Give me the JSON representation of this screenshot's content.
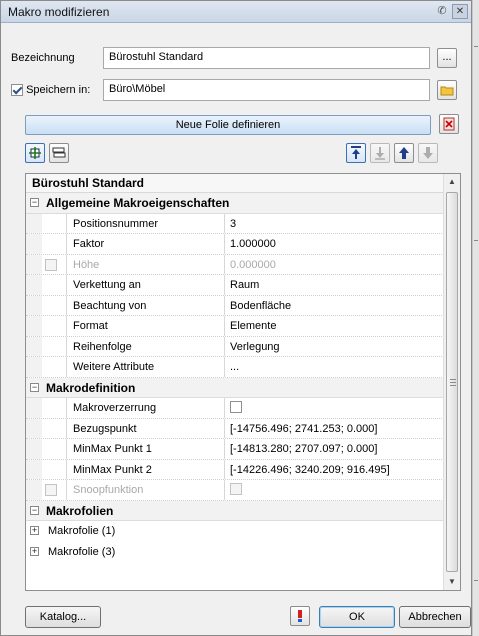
{
  "window": {
    "title": "Makro modifizieren"
  },
  "form": {
    "bezeichnung_label": "Bezeichnung",
    "bezeichnung_value": "Bürostuhl Standard",
    "browse_label": "...",
    "speichern_label": "Speichern in:",
    "speichern_checked": true,
    "speichern_value": "Büro\\Möbel"
  },
  "toolbar": {
    "neue_folie_label": "Neue Folie definieren"
  },
  "grid": {
    "header": "Bürostuhl Standard",
    "groups": {
      "allgemein": "Allgemeine Makroeigenschaften",
      "makrodefinition": "Makrodefinition",
      "makrofolien": "Makrofolien"
    },
    "allgemein_props": [
      {
        "name": "Positionsnummer",
        "value": "3"
      },
      {
        "name": "Faktor",
        "value": "1.000000"
      },
      {
        "name": "Höhe",
        "value": "0.000000",
        "disabled": true,
        "checkbox": false
      },
      {
        "name": "Verkettung an",
        "value": "Raum"
      },
      {
        "name": "Beachtung von",
        "value": "Bodenfläche"
      },
      {
        "name": "Format",
        "value": "Elemente"
      },
      {
        "name": "Reihenfolge",
        "value": "Verlegung"
      },
      {
        "name": "Weitere Attribute",
        "value": "..."
      }
    ],
    "makrodef_props": [
      {
        "name": "Makroverzerrung",
        "value_checkbox": false
      },
      {
        "name": "Bezugspunkt",
        "value": "[-14756.496; 2741.253; 0.000]"
      },
      {
        "name": "MinMax Punkt 1",
        "value": "[-14813.280; 2707.097; 0.000]"
      },
      {
        "name": "MinMax Punkt 2",
        "value": "[-14226.496; 3240.209; 916.495]"
      },
      {
        "name": "Snoopfunktion",
        "disabled": true,
        "value_checkbox": false
      }
    ],
    "folien": [
      "Makrofolie (1)",
      "Makrofolie (3)"
    ]
  },
  "footer": {
    "katalog_label": "Katalog...",
    "ok_label": "OK",
    "abbrechen_label": "Abbrechen"
  }
}
